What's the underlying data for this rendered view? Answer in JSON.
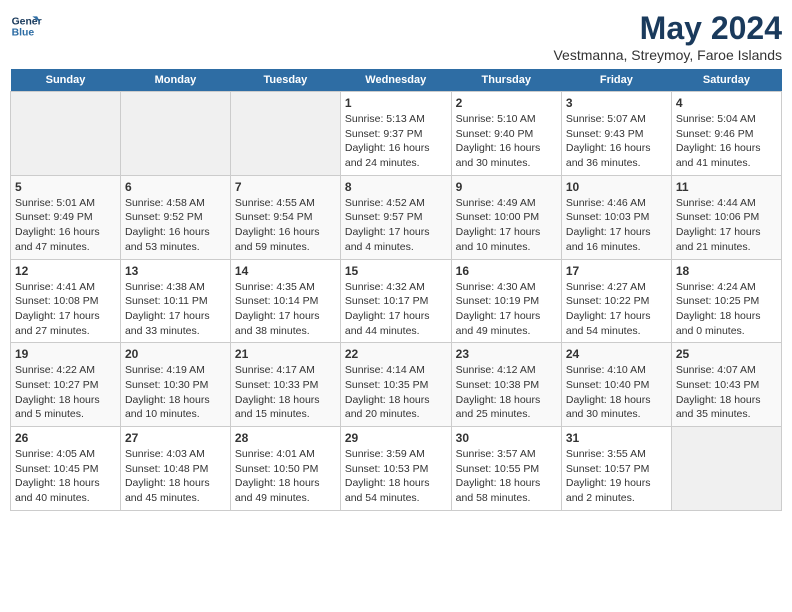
{
  "logo": {
    "line1": "General",
    "line2": "Blue"
  },
  "title": "May 2024",
  "subtitle": "Vestmanna, Streymoy, Faroe Islands",
  "headers": [
    "Sunday",
    "Monday",
    "Tuesday",
    "Wednesday",
    "Thursday",
    "Friday",
    "Saturday"
  ],
  "weeks": [
    [
      {
        "day": "",
        "content": ""
      },
      {
        "day": "",
        "content": ""
      },
      {
        "day": "",
        "content": ""
      },
      {
        "day": "1",
        "content": "Sunrise: 5:13 AM\nSunset: 9:37 PM\nDaylight: 16 hours\nand 24 minutes."
      },
      {
        "day": "2",
        "content": "Sunrise: 5:10 AM\nSunset: 9:40 PM\nDaylight: 16 hours\nand 30 minutes."
      },
      {
        "day": "3",
        "content": "Sunrise: 5:07 AM\nSunset: 9:43 PM\nDaylight: 16 hours\nand 36 minutes."
      },
      {
        "day": "4",
        "content": "Sunrise: 5:04 AM\nSunset: 9:46 PM\nDaylight: 16 hours\nand 41 minutes."
      }
    ],
    [
      {
        "day": "5",
        "content": "Sunrise: 5:01 AM\nSunset: 9:49 PM\nDaylight: 16 hours\nand 47 minutes."
      },
      {
        "day": "6",
        "content": "Sunrise: 4:58 AM\nSunset: 9:52 PM\nDaylight: 16 hours\nand 53 minutes."
      },
      {
        "day": "7",
        "content": "Sunrise: 4:55 AM\nSunset: 9:54 PM\nDaylight: 16 hours\nand 59 minutes."
      },
      {
        "day": "8",
        "content": "Sunrise: 4:52 AM\nSunset: 9:57 PM\nDaylight: 17 hours\nand 4 minutes."
      },
      {
        "day": "9",
        "content": "Sunrise: 4:49 AM\nSunset: 10:00 PM\nDaylight: 17 hours\nand 10 minutes."
      },
      {
        "day": "10",
        "content": "Sunrise: 4:46 AM\nSunset: 10:03 PM\nDaylight: 17 hours\nand 16 minutes."
      },
      {
        "day": "11",
        "content": "Sunrise: 4:44 AM\nSunset: 10:06 PM\nDaylight: 17 hours\nand 21 minutes."
      }
    ],
    [
      {
        "day": "12",
        "content": "Sunrise: 4:41 AM\nSunset: 10:08 PM\nDaylight: 17 hours\nand 27 minutes."
      },
      {
        "day": "13",
        "content": "Sunrise: 4:38 AM\nSunset: 10:11 PM\nDaylight: 17 hours\nand 33 minutes."
      },
      {
        "day": "14",
        "content": "Sunrise: 4:35 AM\nSunset: 10:14 PM\nDaylight: 17 hours\nand 38 minutes."
      },
      {
        "day": "15",
        "content": "Sunrise: 4:32 AM\nSunset: 10:17 PM\nDaylight: 17 hours\nand 44 minutes."
      },
      {
        "day": "16",
        "content": "Sunrise: 4:30 AM\nSunset: 10:19 PM\nDaylight: 17 hours\nand 49 minutes."
      },
      {
        "day": "17",
        "content": "Sunrise: 4:27 AM\nSunset: 10:22 PM\nDaylight: 17 hours\nand 54 minutes."
      },
      {
        "day": "18",
        "content": "Sunrise: 4:24 AM\nSunset: 10:25 PM\nDaylight: 18 hours\nand 0 minutes."
      }
    ],
    [
      {
        "day": "19",
        "content": "Sunrise: 4:22 AM\nSunset: 10:27 PM\nDaylight: 18 hours\nand 5 minutes."
      },
      {
        "day": "20",
        "content": "Sunrise: 4:19 AM\nSunset: 10:30 PM\nDaylight: 18 hours\nand 10 minutes."
      },
      {
        "day": "21",
        "content": "Sunrise: 4:17 AM\nSunset: 10:33 PM\nDaylight: 18 hours\nand 15 minutes."
      },
      {
        "day": "22",
        "content": "Sunrise: 4:14 AM\nSunset: 10:35 PM\nDaylight: 18 hours\nand 20 minutes."
      },
      {
        "day": "23",
        "content": "Sunrise: 4:12 AM\nSunset: 10:38 PM\nDaylight: 18 hours\nand 25 minutes."
      },
      {
        "day": "24",
        "content": "Sunrise: 4:10 AM\nSunset: 10:40 PM\nDaylight: 18 hours\nand 30 minutes."
      },
      {
        "day": "25",
        "content": "Sunrise: 4:07 AM\nSunset: 10:43 PM\nDaylight: 18 hours\nand 35 minutes."
      }
    ],
    [
      {
        "day": "26",
        "content": "Sunrise: 4:05 AM\nSunset: 10:45 PM\nDaylight: 18 hours\nand 40 minutes."
      },
      {
        "day": "27",
        "content": "Sunrise: 4:03 AM\nSunset: 10:48 PM\nDaylight: 18 hours\nand 45 minutes."
      },
      {
        "day": "28",
        "content": "Sunrise: 4:01 AM\nSunset: 10:50 PM\nDaylight: 18 hours\nand 49 minutes."
      },
      {
        "day": "29",
        "content": "Sunrise: 3:59 AM\nSunset: 10:53 PM\nDaylight: 18 hours\nand 54 minutes."
      },
      {
        "day": "30",
        "content": "Sunrise: 3:57 AM\nSunset: 10:55 PM\nDaylight: 18 hours\nand 58 minutes."
      },
      {
        "day": "31",
        "content": "Sunrise: 3:55 AM\nSunset: 10:57 PM\nDaylight: 19 hours\nand 2 minutes."
      },
      {
        "day": "",
        "content": ""
      }
    ]
  ]
}
